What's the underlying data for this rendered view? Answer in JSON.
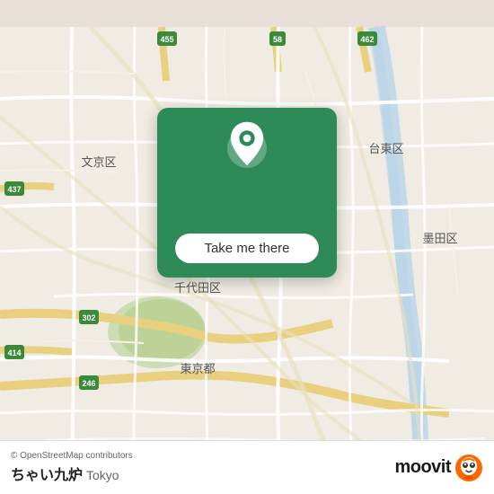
{
  "map": {
    "background_color": "#f0ece4",
    "attribution": "© OpenStreetMap contributors",
    "place_name": "ちゃい九炉",
    "city": "Tokyo"
  },
  "card": {
    "button_label": "Take me there",
    "bg_color": "#2e8b57"
  },
  "moovit": {
    "logo_text": "moovit"
  }
}
